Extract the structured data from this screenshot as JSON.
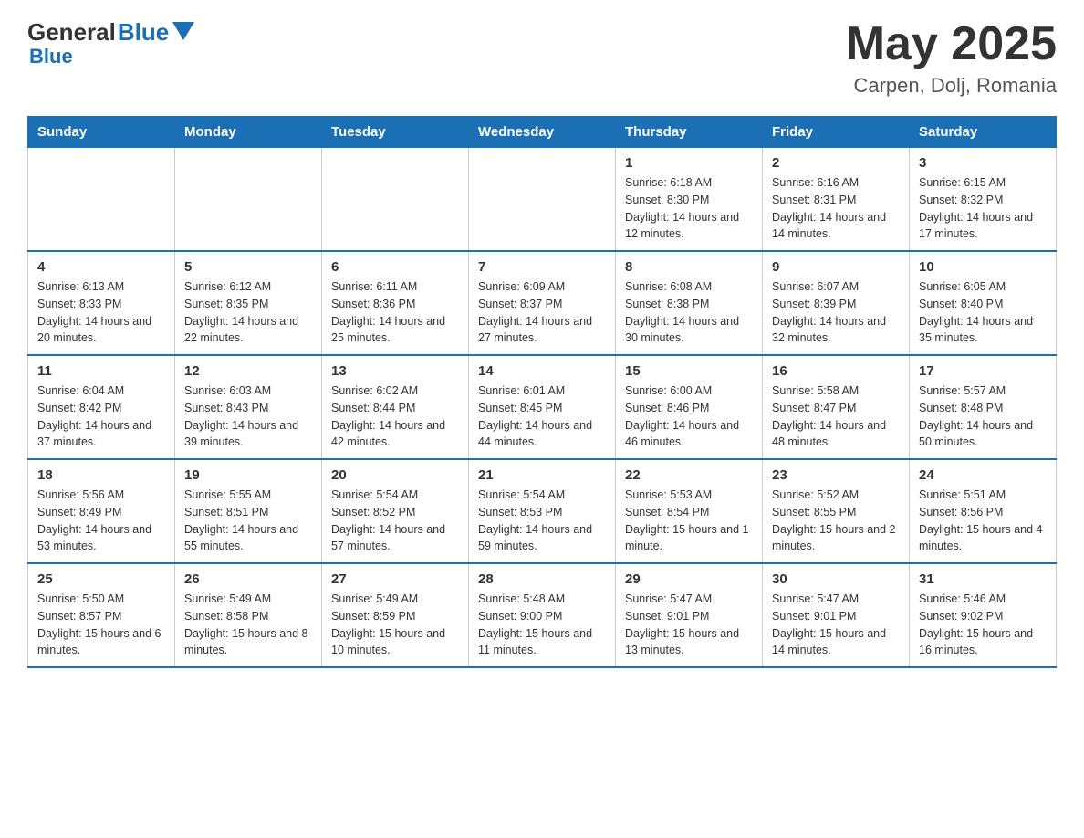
{
  "header": {
    "logo_general": "General",
    "logo_blue": "Blue",
    "title": "May 2025",
    "subtitle": "Carpen, Dolj, Romania"
  },
  "days_of_week": [
    "Sunday",
    "Monday",
    "Tuesday",
    "Wednesday",
    "Thursday",
    "Friday",
    "Saturday"
  ],
  "weeks": [
    [
      {
        "day": "",
        "info": ""
      },
      {
        "day": "",
        "info": ""
      },
      {
        "day": "",
        "info": ""
      },
      {
        "day": "",
        "info": ""
      },
      {
        "day": "1",
        "info": "Sunrise: 6:18 AM\nSunset: 8:30 PM\nDaylight: 14 hours and 12 minutes."
      },
      {
        "day": "2",
        "info": "Sunrise: 6:16 AM\nSunset: 8:31 PM\nDaylight: 14 hours and 14 minutes."
      },
      {
        "day": "3",
        "info": "Sunrise: 6:15 AM\nSunset: 8:32 PM\nDaylight: 14 hours and 17 minutes."
      }
    ],
    [
      {
        "day": "4",
        "info": "Sunrise: 6:13 AM\nSunset: 8:33 PM\nDaylight: 14 hours and 20 minutes."
      },
      {
        "day": "5",
        "info": "Sunrise: 6:12 AM\nSunset: 8:35 PM\nDaylight: 14 hours and 22 minutes."
      },
      {
        "day": "6",
        "info": "Sunrise: 6:11 AM\nSunset: 8:36 PM\nDaylight: 14 hours and 25 minutes."
      },
      {
        "day": "7",
        "info": "Sunrise: 6:09 AM\nSunset: 8:37 PM\nDaylight: 14 hours and 27 minutes."
      },
      {
        "day": "8",
        "info": "Sunrise: 6:08 AM\nSunset: 8:38 PM\nDaylight: 14 hours and 30 minutes."
      },
      {
        "day": "9",
        "info": "Sunrise: 6:07 AM\nSunset: 8:39 PM\nDaylight: 14 hours and 32 minutes."
      },
      {
        "day": "10",
        "info": "Sunrise: 6:05 AM\nSunset: 8:40 PM\nDaylight: 14 hours and 35 minutes."
      }
    ],
    [
      {
        "day": "11",
        "info": "Sunrise: 6:04 AM\nSunset: 8:42 PM\nDaylight: 14 hours and 37 minutes."
      },
      {
        "day": "12",
        "info": "Sunrise: 6:03 AM\nSunset: 8:43 PM\nDaylight: 14 hours and 39 minutes."
      },
      {
        "day": "13",
        "info": "Sunrise: 6:02 AM\nSunset: 8:44 PM\nDaylight: 14 hours and 42 minutes."
      },
      {
        "day": "14",
        "info": "Sunrise: 6:01 AM\nSunset: 8:45 PM\nDaylight: 14 hours and 44 minutes."
      },
      {
        "day": "15",
        "info": "Sunrise: 6:00 AM\nSunset: 8:46 PM\nDaylight: 14 hours and 46 minutes."
      },
      {
        "day": "16",
        "info": "Sunrise: 5:58 AM\nSunset: 8:47 PM\nDaylight: 14 hours and 48 minutes."
      },
      {
        "day": "17",
        "info": "Sunrise: 5:57 AM\nSunset: 8:48 PM\nDaylight: 14 hours and 50 minutes."
      }
    ],
    [
      {
        "day": "18",
        "info": "Sunrise: 5:56 AM\nSunset: 8:49 PM\nDaylight: 14 hours and 53 minutes."
      },
      {
        "day": "19",
        "info": "Sunrise: 5:55 AM\nSunset: 8:51 PM\nDaylight: 14 hours and 55 minutes."
      },
      {
        "day": "20",
        "info": "Sunrise: 5:54 AM\nSunset: 8:52 PM\nDaylight: 14 hours and 57 minutes."
      },
      {
        "day": "21",
        "info": "Sunrise: 5:54 AM\nSunset: 8:53 PM\nDaylight: 14 hours and 59 minutes."
      },
      {
        "day": "22",
        "info": "Sunrise: 5:53 AM\nSunset: 8:54 PM\nDaylight: 15 hours and 1 minute."
      },
      {
        "day": "23",
        "info": "Sunrise: 5:52 AM\nSunset: 8:55 PM\nDaylight: 15 hours and 2 minutes."
      },
      {
        "day": "24",
        "info": "Sunrise: 5:51 AM\nSunset: 8:56 PM\nDaylight: 15 hours and 4 minutes."
      }
    ],
    [
      {
        "day": "25",
        "info": "Sunrise: 5:50 AM\nSunset: 8:57 PM\nDaylight: 15 hours and 6 minutes."
      },
      {
        "day": "26",
        "info": "Sunrise: 5:49 AM\nSunset: 8:58 PM\nDaylight: 15 hours and 8 minutes."
      },
      {
        "day": "27",
        "info": "Sunrise: 5:49 AM\nSunset: 8:59 PM\nDaylight: 15 hours and 10 minutes."
      },
      {
        "day": "28",
        "info": "Sunrise: 5:48 AM\nSunset: 9:00 PM\nDaylight: 15 hours and 11 minutes."
      },
      {
        "day": "29",
        "info": "Sunrise: 5:47 AM\nSunset: 9:01 PM\nDaylight: 15 hours and 13 minutes."
      },
      {
        "day": "30",
        "info": "Sunrise: 5:47 AM\nSunset: 9:01 PM\nDaylight: 15 hours and 14 minutes."
      },
      {
        "day": "31",
        "info": "Sunrise: 5:46 AM\nSunset: 9:02 PM\nDaylight: 15 hours and 16 minutes."
      }
    ]
  ]
}
